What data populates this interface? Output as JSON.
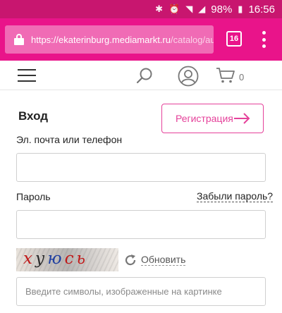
{
  "status_bar": {
    "battery": "98%",
    "time": "16:56",
    "icons": [
      "bluetooth-icon",
      "alarm-icon",
      "wifi-icon",
      "signal-icon",
      "battery-icon"
    ]
  },
  "browser": {
    "url_host": "https://ekaterinburg.mediamarkt.ru",
    "url_rest": "/catalog/auto?utm",
    "tab_count": "16",
    "accent_color": "#e9148a"
  },
  "header": {
    "cart_count": "0"
  },
  "login": {
    "title": "Вход",
    "register_label": "Регистрация",
    "email_label": "Эл. почта или телефон",
    "email_value": "",
    "password_label": "Пароль",
    "password_value": "",
    "forgot_label": "Забыли пароль?",
    "captcha_text": "хуюсь",
    "refresh_label": "Обновить",
    "captcha_placeholder": "Введите символы, изображенные на картинке",
    "brand_color": "#e5419a"
  }
}
